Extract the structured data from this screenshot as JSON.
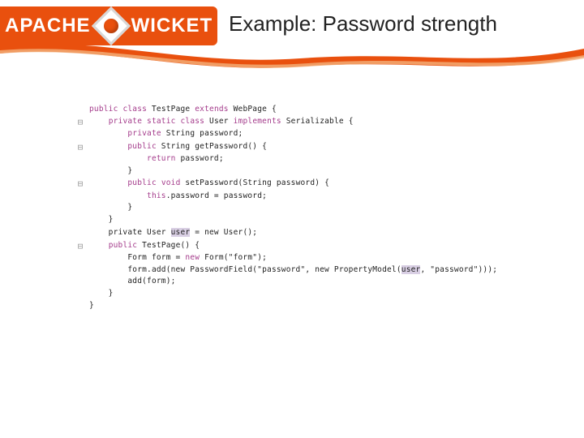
{
  "brand": {
    "left": "APACHE",
    "right": "WICKET"
  },
  "title": "Example: Password strength",
  "gutter": {
    "collapse": "⊟"
  },
  "code": {
    "l0": "public class TestPage extends WebPage {",
    "l1a": "    private static class User implements Serializable {",
    "l2": "        private String password;",
    "l3": "",
    "l4a": "        public String getPassword() {",
    "l5": "            return password;",
    "l6": "        }",
    "l7": "",
    "l8a": "        public void setPassword(String password) {",
    "l9": "            this.password = password;",
    "l10": "        }",
    "l11": "    }",
    "l12": "",
    "l13_pre": "    private User ",
    "l13_hl": "user",
    "l13_post": " = new User();",
    "l14": "",
    "l15a": "    public TestPage() {",
    "l16": "        Form form = new Form(\"form\");",
    "l17_pre": "        form.add(new PasswordField(\"password\", new PropertyModel(",
    "l17_hl": "user",
    "l17_post": ", \"password\")));",
    "l18": "        add(form);",
    "l19": "    }",
    "l20": "}"
  }
}
